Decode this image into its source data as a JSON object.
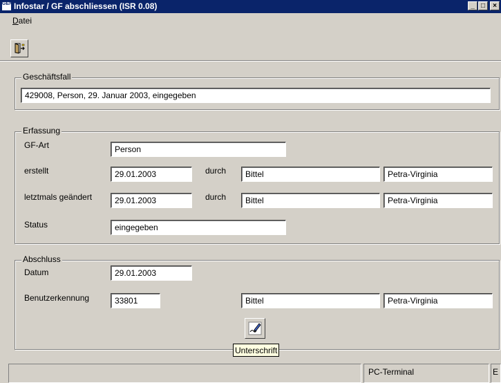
{
  "window": {
    "icon_text": "GEN",
    "title": "Infostar / GF abschliessen (ISR 0.08)",
    "minimize_glyph": "_",
    "maximize_glyph": "□",
    "close_glyph": "×"
  },
  "menu": {
    "items": [
      {
        "mnemonic": "D",
        "rest": "atei"
      }
    ]
  },
  "toolbar": {
    "exit_icon": "exit-door-icon"
  },
  "geschaeftsfall": {
    "title": "Geschäftsfall",
    "value": "429008, Person, 29. Januar 2003, eingegeben"
  },
  "erfassung": {
    "title": "Erfassung",
    "gf_art_label": "GF-Art",
    "gf_art_value": "Person",
    "erstellt_label": "erstellt",
    "erstellt_date": "29.01.2003",
    "erstellt_durch_label": "durch",
    "erstellt_lastname": "Bittel",
    "erstellt_firstname": "Petra-Virginia",
    "geaendert_label": "letztmals geändert",
    "geaendert_date": "29.01.2003",
    "geaendert_durch_label": "durch",
    "geaendert_lastname": "Bittel",
    "geaendert_firstname": "Petra-Virginia",
    "status_label": "Status",
    "status_value": "eingegeben"
  },
  "abschluss": {
    "title": "Abschluss",
    "datum_label": "Datum",
    "datum_value": "29.01.2003",
    "benutzer_label": "Benutzerkennung",
    "benutzer_value": "33801",
    "lastname": "Bittel",
    "firstname": "Petra-Virginia",
    "signature_icon": "signature-pen-icon",
    "signature_tooltip": "Unterschrift"
  },
  "statusbar": {
    "main": "",
    "terminal": "PC-Terminal",
    "mode": "E"
  }
}
